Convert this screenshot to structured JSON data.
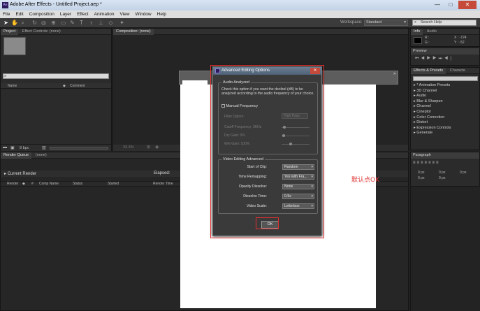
{
  "window": {
    "title": "Adobe After Effects - Untitled Project.aep *",
    "app_icon_text": "Ae",
    "minimize": "—",
    "maximize": "□",
    "close": "✕"
  },
  "menu": [
    "File",
    "Edit",
    "Composition",
    "Layer",
    "Effect",
    "Animation",
    "View",
    "Window",
    "Help"
  ],
  "toolbar": {
    "workspace_label": "Workspace:",
    "workspace_value": "Standard",
    "search_placeholder": "Search Help"
  },
  "project_panel": {
    "tab_project": "Project",
    "tab_effect_controls": "Effect Controls: (none)",
    "col_name": "Name",
    "col_comment": "Comment",
    "bpc": "8 bpc"
  },
  "composition_panel": {
    "tab": "Composition: (none)",
    "zoom": "33.3%"
  },
  "render_queue": {
    "tab_render": "Render Queue",
    "tab_none": "(none)",
    "current_render": "Current Render",
    "elapsed": "Elapsed:",
    "columns": [
      "Render",
      "#",
      "Comp Name",
      "Status",
      "Started",
      "Render Time"
    ]
  },
  "info_panel": {
    "tab_info": "Info",
    "tab_audio": "Audio",
    "r": "R :",
    "g": "G :",
    "x": "X : -724",
    "y": "Y : -52"
  },
  "preview_panel": {
    "tab": "Preview"
  },
  "effects_panel": {
    "tab_effects": "Effects & Presets",
    "tab_character": "Characte",
    "items": [
      "* Animation Presets",
      "3D Channel",
      "Audio",
      "Blur & Sharpen",
      "Channel",
      "Cineptor",
      "Color Correction",
      "Distort",
      "Expression Controls",
      "Generate"
    ]
  },
  "paragraph_panel": {
    "tab": "Paragraph",
    "px_values": [
      "0 px",
      "0 px",
      "0 px",
      "0 px",
      "0 px"
    ]
  },
  "dialog": {
    "title": "Advanced Editing Options",
    "close": "✕",
    "audio_group": "Audio Analyzed",
    "audio_desc": "Check this option if you want the decibel (dB) to be analyzed according to the audio frequency of your choice.",
    "manual_frequency": "Manual Frequency",
    "filter_option_label": "Filter Option:",
    "filter_option_value": "High Pass",
    "cutoff_label": "Cutoff Frequency: 3KHz",
    "dry_label": "Dry Gain: 0%",
    "wet_label": "Wet Gain: 100%",
    "video_group": "Video Editing Advanced",
    "rows": [
      {
        "label": "Start of Clip:",
        "value": "Random"
      },
      {
        "label": "Time Remapping:",
        "value": "Yes with Fra..."
      },
      {
        "label": "Opacity Dissolve:",
        "value": "None"
      },
      {
        "label": "Dissolve Time:",
        "value": "0.5s"
      },
      {
        "label": "Video Scale:",
        "value": "Letterbox"
      }
    ],
    "ok": "OK"
  },
  "annotation": "默认点OK",
  "colors": {
    "highlight": "#e03030",
    "panel_bg": "#2b2b2b",
    "dialog_title": "#5a6c82"
  }
}
